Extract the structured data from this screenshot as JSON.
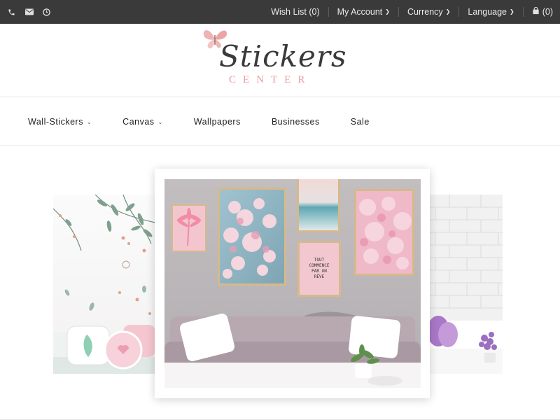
{
  "topbar": {
    "contact_icons": [
      "phone-icon",
      "envelope-icon",
      "clock-icon"
    ],
    "links": [
      {
        "label": "Wish List (0)",
        "dropdown": false
      },
      {
        "label": "My Account",
        "dropdown": true
      },
      {
        "label": "Currency",
        "dropdown": true
      },
      {
        "label": "Language",
        "dropdown": true
      }
    ],
    "cart": {
      "icon": "shopping-bag-icon",
      "label": "(0)"
    }
  },
  "logo": {
    "script_text": "Stickers",
    "sub_text": "CENTER",
    "icon": "butterfly-icon"
  },
  "nav": {
    "items": [
      {
        "label": "Wall-Stickers",
        "dropdown": true
      },
      {
        "label": "Canvas",
        "dropdown": true
      },
      {
        "label": "Wallpapers",
        "dropdown": false
      },
      {
        "label": "Businesses",
        "dropdown": false
      },
      {
        "label": "Sale",
        "dropdown": false
      }
    ]
  },
  "hero": {
    "poster_text": "TOUT COMMENCE PAR UN RÊVE"
  },
  "colors": {
    "topbar_bg": "#3a3a3a",
    "accent_pink": "#e8a0a0",
    "text_dark": "#222222"
  }
}
